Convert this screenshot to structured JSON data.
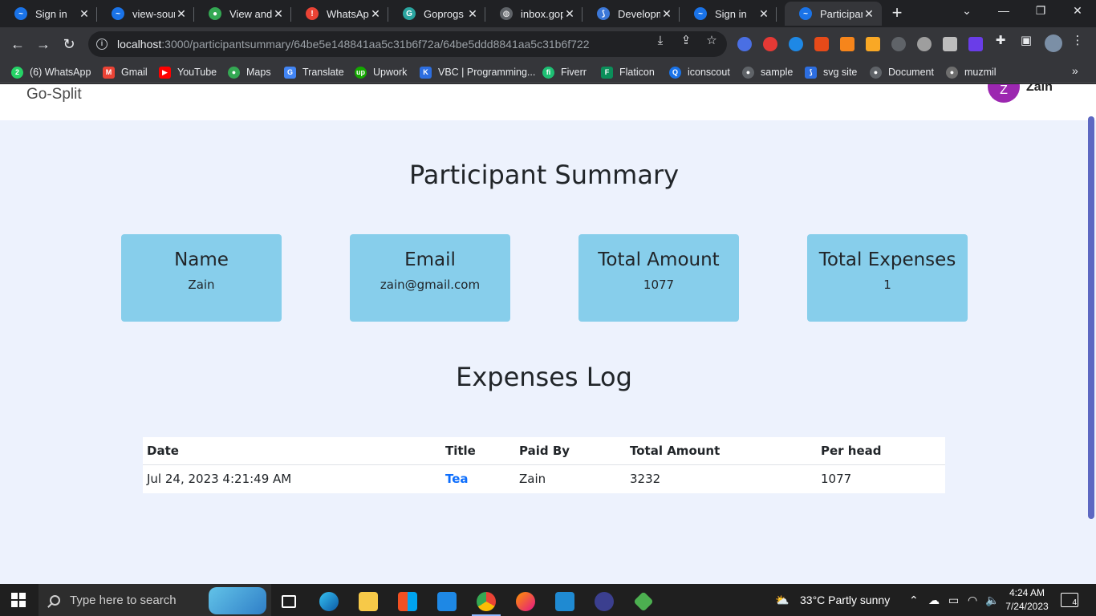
{
  "browser": {
    "tabs": [
      {
        "title": "Sign in",
        "favicon": "gopgrogs-icon",
        "color": "#1a73e8"
      },
      {
        "title": "view-source",
        "favicon": "gopgrogs-icon",
        "color": "#1a73e8"
      },
      {
        "title": "View and edit",
        "favicon": "chrome-icon",
        "color": "#34a853"
      },
      {
        "title": "WhatsApp",
        "favicon": "alert-icon",
        "color": "#ea4335"
      },
      {
        "title": "Goprogs Cl",
        "favicon": "goprogs-icon",
        "color": "#2aa5a0"
      },
      {
        "title": "inbox.gopr",
        "favicon": "globe-icon",
        "color": "#5f6368"
      },
      {
        "title": "Developme",
        "favicon": "dev-icon",
        "color": "#3c78d8"
      },
      {
        "title": "Sign in",
        "favicon": "gopgrogs-icon",
        "color": "#1a73e8"
      },
      {
        "title": "Participant",
        "favicon": "gopgrogs-icon",
        "color": "#1a73e8"
      }
    ],
    "url_host": "localhost",
    "url_path": ":3000/participantsummary/64be5e148841aa5c31b6f72a/64be5ddd8841aa5c31b6f722",
    "bookmarks": [
      {
        "label": "(6) WhatsApp",
        "color": "#25d366",
        "glyph": "2"
      },
      {
        "label": "Gmail",
        "color": "#ea4335",
        "glyph": "M"
      },
      {
        "label": "YouTube",
        "color": "#ff0000",
        "glyph": "▶"
      },
      {
        "label": "Maps",
        "color": "#34a853",
        "glyph": "●"
      },
      {
        "label": "Translate",
        "color": "#4285f4",
        "glyph": "G"
      },
      {
        "label": "Upwork",
        "color": "#14a800",
        "glyph": "up"
      },
      {
        "label": "VBC | Programming...",
        "color": "#2d6ee0",
        "glyph": "K"
      },
      {
        "label": "Fiverr",
        "color": "#1dbf73",
        "glyph": "fi"
      },
      {
        "label": "Flaticon",
        "color": "#0b8f5a",
        "glyph": "F"
      },
      {
        "label": "iconscout",
        "color": "#1a73e8",
        "glyph": "Q"
      },
      {
        "label": "sample",
        "color": "#5f6368",
        "glyph": "●"
      },
      {
        "label": "svg site",
        "color": "#2d6ee0",
        "glyph": "⟆"
      },
      {
        "label": "Document",
        "color": "#5f6368",
        "glyph": "●"
      },
      {
        "label": "muzmil",
        "color": "#6e6e6e",
        "glyph": "●"
      }
    ]
  },
  "app": {
    "brand": "Go-Split",
    "avatar_initial": "Z",
    "username": "Zain",
    "page_title": "Participant Summary",
    "summary_cards": [
      {
        "label": "Name",
        "value": "Zain"
      },
      {
        "label": "Email",
        "value": "zain@gmail.com"
      },
      {
        "label": "Total Amount",
        "value": "1077"
      },
      {
        "label": "Total Expenses",
        "value": "1"
      }
    ],
    "log_title": "Expenses Log",
    "table": {
      "headers": [
        "Date",
        "Title",
        "Paid By",
        "Total Amount",
        "Per head"
      ],
      "rows": [
        [
          "Jul 24, 2023 4:21:49 AM",
          "Tea",
          "Zain",
          "3232",
          "1077"
        ]
      ]
    },
    "accent_color": "#87ceeb",
    "background_color": "#edf2fd"
  },
  "taskbar": {
    "search_placeholder": "Type here to search",
    "weather": "33°C  Partly sunny",
    "time": "4:24 AM",
    "date": "7/24/2023",
    "notifications": "4"
  }
}
